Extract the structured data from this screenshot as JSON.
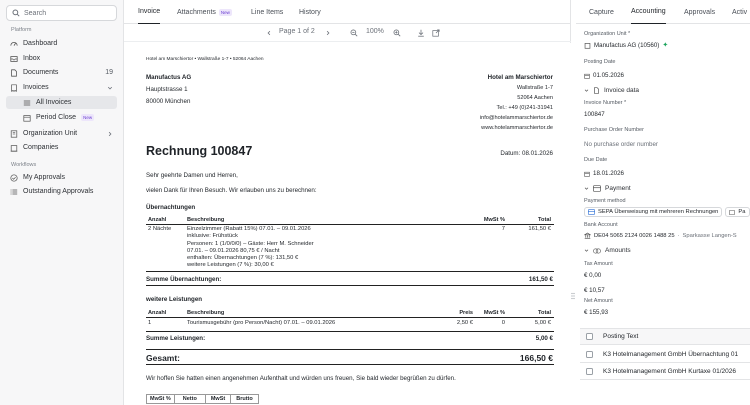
{
  "sidebar": {
    "search_placeholder": "Search",
    "platform_label": "Platform",
    "workflows_label": "Workflows",
    "items": [
      {
        "label": "Dashboard"
      },
      {
        "label": "Inbox"
      },
      {
        "label": "Documents",
        "count": "19"
      },
      {
        "label": "Invoices"
      },
      {
        "label": "All Invoices"
      },
      {
        "label": "Period Close",
        "badge": "New"
      },
      {
        "label": "Organization Unit"
      },
      {
        "label": "Companies"
      },
      {
        "label": "My Approvals"
      },
      {
        "label": "Outstanding Approvals"
      }
    ]
  },
  "center_tabs": [
    {
      "label": "Invoice"
    },
    {
      "label": "Attachments",
      "badge": "New"
    },
    {
      "label": "Line Items"
    },
    {
      "label": "History"
    }
  ],
  "toolbar": {
    "page": "Page 1 of 2",
    "zoom": "100%"
  },
  "document": {
    "sender_line": "Hotel am Marschiertor • Wallstraße 1-7 • 52064 Aachen",
    "recipient": [
      "Manufactus AG",
      "Hauptstrasse 1",
      "80000 München"
    ],
    "hotel": [
      "Hotel am Marschiertor",
      "Wallstraße 1-7",
      "52064 Aachen",
      "Tel.: +49 (0)241-31941",
      "info@hotelammarschiertor.de",
      "www.hotelammarschiertor.de"
    ],
    "title": "Rechnung 100847",
    "date": "Datum: 08.01.2026",
    "greeting": "Sehr geehrte Damen und Herren,",
    "intro": "vielen Dank für Ihren Besuch. Wir erlauben uns zu berechnen:",
    "section1": "Übernachtungen",
    "col_anzahl": "Anzahl",
    "col_beschreibung": "Beschreibung",
    "col_mwst": "MwSt %",
    "col_total": "Total",
    "col_preis": "Preis",
    "row1_anzahl": "2 Nächte",
    "row1_lines": [
      "Einzelzimmer (Rabatt 15%) 07.01. – 09.01.2026",
      "inklusive: Frühstück",
      "Personen: 1 (1/0/0/0) – Gäste: Herr M. Schneider",
      "07.01. – 09.01.2026   80,75 € / Nacht",
      "enthalten: Übernachtungen (7 %): 131,50 €",
      "weitere Leistungen (7 %): 30,00 €"
    ],
    "row1_mwst": "7",
    "row1_total": "161,50 €",
    "sum1_label": "Summe Übernachtungen:",
    "sum1_value": "161,50 €",
    "section2": "weitere Leistungen",
    "row2_anzahl": "1",
    "row2_desc": "Tourismusgebühr (pro Person/Nacht) 07.01. – 09.01.2026",
    "row2_preis": "2,50 €",
    "row2_mwst": "0",
    "row2_total": "5,00 €",
    "sum2_label": "Summe Leistungen:",
    "sum2_value": "5,00 €",
    "gesamt_label": "Gesamt:",
    "gesamt_value": "166,50 €",
    "closing": "Wir hoffen Sie hatten einen angenehmen Aufenthalt und würden uns freuen, Sie bald wieder begrüßen zu dürfen.",
    "summary_headers": [
      "MwSt %",
      "Netto",
      "MwSt",
      "Brutto"
    ]
  },
  "right_tabs": [
    {
      "label": "Capture"
    },
    {
      "label": "Accounting"
    },
    {
      "label": "Approvals"
    },
    {
      "label": "Activ"
    }
  ],
  "accounting": {
    "org_unit_label": "Organization Unit *",
    "org_unit_value": "Manufactus AG (10560)",
    "posting_date_label": "Posting Date",
    "posting_date_value": "01.05.2026",
    "invoice_data_label": "Invoice data",
    "invoice_number_label": "Invoice Number *",
    "invoice_number_value": "100847",
    "po_label": "Purchase Order Number",
    "po_value": "No purchase order number",
    "due_date_label": "Due Date",
    "due_date_value": "18.01.2026",
    "payment_label": "Payment",
    "payment_method_label": "Payment method",
    "payment_method_value": "SEPA Überweisung mit mehreren Rechnungen",
    "payment_method_extra": "Pa",
    "bank_account_label": "Bank Account",
    "bank_account_value": "DE04 5065 2124 0026 1488 25",
    "bank_account_name": "Sparkasse Langen-S",
    "amounts_label": "Amounts",
    "tax_amount_label": "Tax Amount",
    "tax_amount_value": "€ 0,00",
    "unlabeled_amount_value": "€ 10,57",
    "net_amount_label": "Net Amount",
    "net_amount_value": "€ 155,93",
    "posting_text_header": "Posting Text",
    "posting_rows": [
      "K3 Hotelmanagement GmbH Übernachtung 01",
      "K3 Hotelmanagement GmbH Kurtaxe 01/2026"
    ]
  },
  "colors": {
    "accent": "#1f2328",
    "badge_bg": "#ede6fb",
    "badge_fg": "#6b3fd1",
    "ai_green": "#1aa35b"
  }
}
